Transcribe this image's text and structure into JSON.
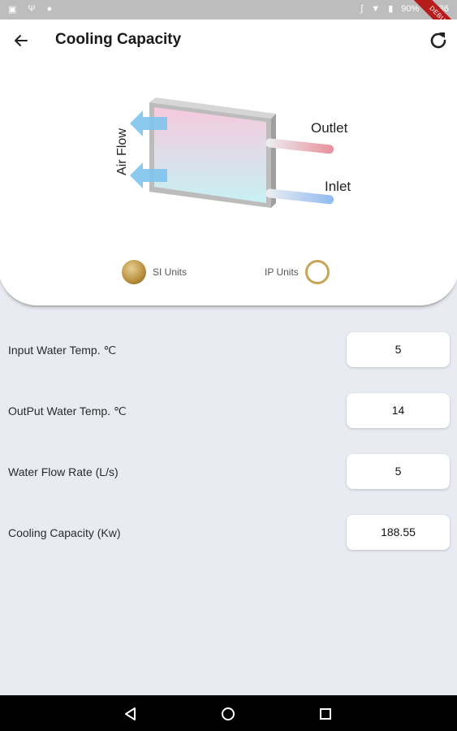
{
  "status_bar": {
    "battery": "90%",
    "time": "11:36",
    "debug_label": "DEBUG"
  },
  "app_bar": {
    "title": "Cooling Capacity"
  },
  "diagram": {
    "outlet_label": "Outlet",
    "inlet_label": "Inlet",
    "airflow_label": "Air Flow"
  },
  "units": {
    "si_label": "SI Units",
    "ip_label": "IP Units",
    "selected": "SI Units"
  },
  "fields": [
    {
      "label": "Input Water Temp. ℃",
      "value": "5"
    },
    {
      "label": "OutPut Water Temp. ℃",
      "value": "14"
    },
    {
      "label": "Water Flow Rate (L/s)",
      "value": "5"
    },
    {
      "label": "Cooling Capacity (Kw)",
      "value": "188.55"
    }
  ],
  "colors": {
    "accent_gold": "#c8a556",
    "background": "#e8ebf2",
    "card": "#ffffff"
  }
}
